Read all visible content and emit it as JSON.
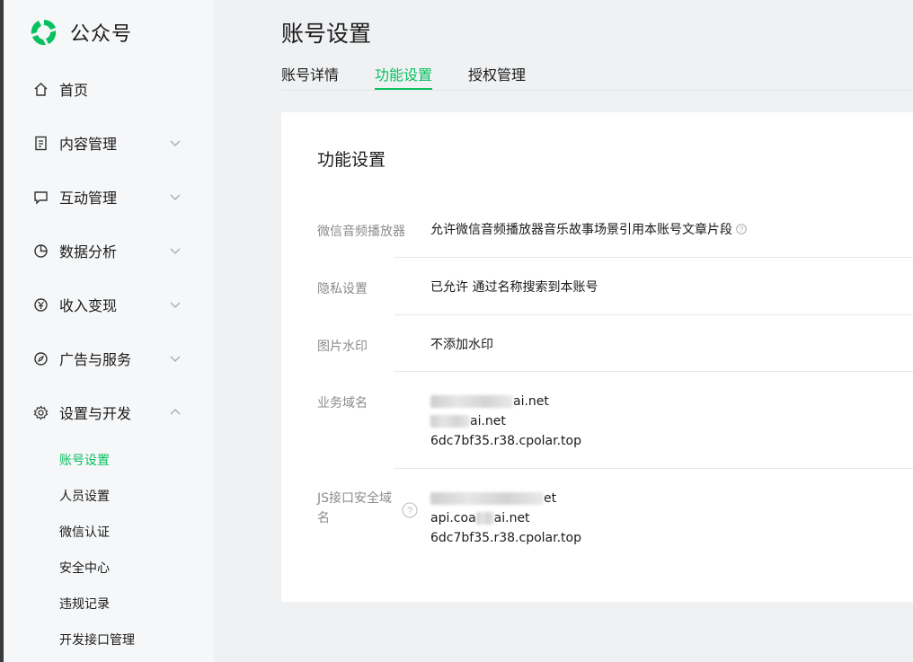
{
  "brand": {
    "name": "公众号",
    "logo_color": "#07c160"
  },
  "sidebar": {
    "items": [
      {
        "label": "首页",
        "icon": "home-icon"
      },
      {
        "label": "内容管理",
        "icon": "document-icon",
        "expanded": false
      },
      {
        "label": "互动管理",
        "icon": "chat-icon",
        "expanded": false
      },
      {
        "label": "数据分析",
        "icon": "pie-chart-icon",
        "expanded": false
      },
      {
        "label": "收入变现",
        "icon": "yen-icon",
        "expanded": false
      },
      {
        "label": "广告与服务",
        "icon": "compass-icon",
        "expanded": false
      },
      {
        "label": "设置与开发",
        "icon": "gear-icon",
        "expanded": true
      }
    ],
    "sub_items": [
      {
        "label": "账号设置",
        "active": true
      },
      {
        "label": "人员设置"
      },
      {
        "label": "微信认证"
      },
      {
        "label": "安全中心"
      },
      {
        "label": "违规记录"
      },
      {
        "label": "开发接口管理"
      }
    ]
  },
  "header": {
    "title": "账号设置",
    "tabs": [
      {
        "label": "账号详情"
      },
      {
        "label": "功能设置",
        "active": true
      },
      {
        "label": "授权管理"
      }
    ]
  },
  "card": {
    "title": "功能设置",
    "rows": [
      {
        "label": "微信音频播放器",
        "value": "允许微信音频播放器音乐故事场景引用本账号文章片段"
      },
      {
        "label": "隐私设置",
        "value": "已允许 通过名称搜索到本账号"
      },
      {
        "label": "图片水印",
        "value": "不添加水印"
      },
      {
        "label": "业务域名",
        "values": [
          "ai.net",
          "ai.net",
          "6dc7bf35.r38.cpolar.top"
        ]
      },
      {
        "label_line1": "JS接口安全域",
        "label_line2": "名",
        "values": [
          "et",
          "api.coa",
          "ai.net",
          "6dc7bf35.r38.cpolar.top"
        ]
      }
    ]
  },
  "colors": {
    "accent": "#07c160",
    "label": "#8c8c8c",
    "background": "#f0f1f3"
  }
}
